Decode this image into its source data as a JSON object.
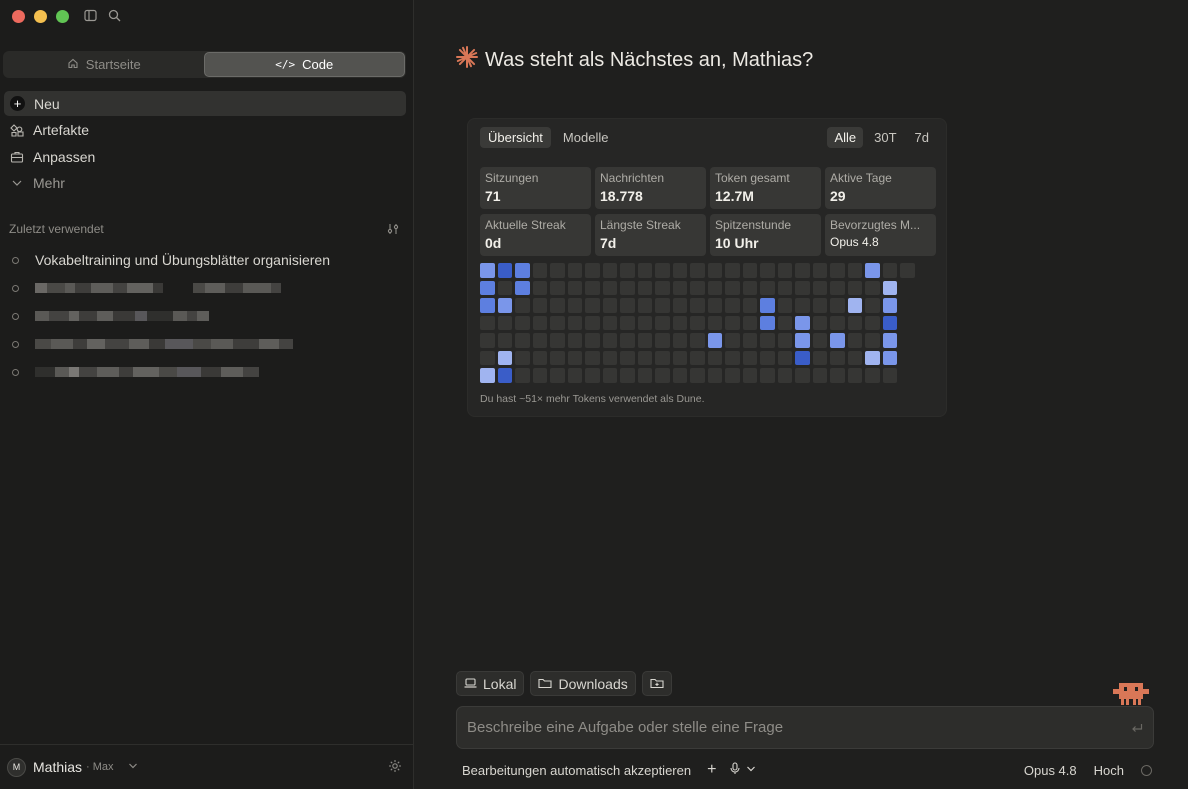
{
  "sidebar": {
    "segments": [
      {
        "label": "Startseite",
        "icon": "home-icon",
        "active": false
      },
      {
        "label": "Code",
        "icon": "code-icon",
        "active": true
      }
    ],
    "nav": [
      {
        "label": "Neu",
        "icon": "plus-icon"
      },
      {
        "label": "Artefakte",
        "icon": "artifacts-icon"
      },
      {
        "label": "Anpassen",
        "icon": "briefcase-icon"
      },
      {
        "label": "Mehr",
        "icon": "chevron-down-icon"
      }
    ],
    "recent_title": "Zuletzt verwendet",
    "recent_items": [
      {
        "label": "Vokabeltraining und Übungsblätter organisieren"
      }
    ],
    "user": {
      "initial": "M",
      "name": "Mathias",
      "plan": "· Max"
    }
  },
  "main": {
    "greeting": "Was steht als Nächstes an, Mathias?",
    "stats": {
      "tabs": [
        "Übersicht",
        "Modelle"
      ],
      "ranges": [
        "Alle",
        "30T",
        "7d"
      ],
      "cards": [
        {
          "label": "Sitzungen",
          "value": "71"
        },
        {
          "label": "Nachrichten",
          "value": "18.778"
        },
        {
          "label": "Token gesamt",
          "value": "12.7M"
        },
        {
          "label": "Aktive Tage",
          "value": "29"
        },
        {
          "label": "Aktuelle Streak",
          "value": "0d"
        },
        {
          "label": "Längste Streak",
          "value": "7d"
        },
        {
          "label": "Spitzenstunde",
          "value": "10 Uhr"
        },
        {
          "label": "Bevorzugtes M...",
          "value": "Opus 4.8"
        }
      ],
      "heatmap": [
        [
          2,
          4,
          3,
          0,
          0,
          0,
          0,
          0,
          0,
          0,
          0,
          0,
          0,
          0,
          0,
          0,
          0,
          0,
          0,
          0,
          0,
          0,
          2,
          0,
          0
        ],
        [
          3,
          0,
          3,
          0,
          0,
          0,
          0,
          0,
          0,
          0,
          0,
          0,
          0,
          0,
          0,
          0,
          0,
          0,
          0,
          0,
          0,
          0,
          0,
          1,
          -1
        ],
        [
          3,
          2,
          0,
          0,
          0,
          0,
          0,
          0,
          0,
          0,
          0,
          0,
          0,
          0,
          0,
          0,
          3,
          0,
          0,
          0,
          0,
          1,
          0,
          2,
          -1
        ],
        [
          0,
          0,
          0,
          0,
          0,
          0,
          0,
          0,
          0,
          0,
          0,
          0,
          0,
          0,
          0,
          0,
          3,
          0,
          2,
          0,
          0,
          0,
          0,
          4,
          -1
        ],
        [
          0,
          0,
          0,
          0,
          0,
          0,
          0,
          0,
          0,
          0,
          0,
          0,
          0,
          2,
          0,
          0,
          0,
          0,
          2,
          0,
          2,
          0,
          0,
          2,
          -1
        ],
        [
          0,
          1,
          0,
          0,
          0,
          0,
          0,
          0,
          0,
          0,
          0,
          0,
          0,
          0,
          0,
          0,
          0,
          0,
          4,
          0,
          0,
          0,
          1,
          2,
          -1
        ],
        [
          1,
          4,
          0,
          0,
          0,
          0,
          0,
          0,
          0,
          0,
          0,
          0,
          0,
          0,
          0,
          0,
          0,
          0,
          0,
          0,
          0,
          0,
          0,
          0,
          -1
        ]
      ],
      "note": "Du hast ~51× mehr Tokens verwendet als Dune."
    },
    "chips": [
      {
        "label": "Lokal",
        "icon": "laptop-icon"
      },
      {
        "label": "Downloads",
        "icon": "folder-icon"
      }
    ],
    "prompt_placeholder": "Beschreibe eine Aufgabe oder stelle eine Frage",
    "auto_accept_label": "Bearbeitungen automatisch akzeptieren",
    "model_label": "Opus 4.8",
    "effort_label": "Hoch"
  },
  "colors": {
    "accent": "#d97757",
    "heat_levels": [
      "#363634",
      "#a0b4f0",
      "#7a96ea",
      "#5d7fe0",
      "#3a5dc8"
    ]
  }
}
